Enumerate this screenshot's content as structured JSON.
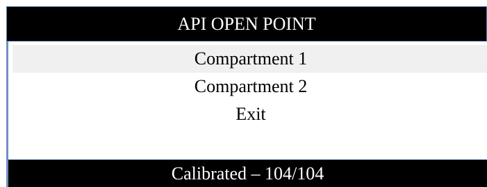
{
  "header": {
    "title": "API OPEN POINT"
  },
  "menu": {
    "items": [
      {
        "label": "Compartment 1",
        "selected": true
      },
      {
        "label": "Compartment 2",
        "selected": false
      },
      {
        "label": "Exit",
        "selected": false
      }
    ]
  },
  "footer": {
    "status": "Calibrated – 104/104"
  },
  "colors": {
    "bar_background": "#000000",
    "bar_text": "#ffffff",
    "selection_highlight": "#f0f0f0",
    "border_accent": "#6f8fc0"
  }
}
